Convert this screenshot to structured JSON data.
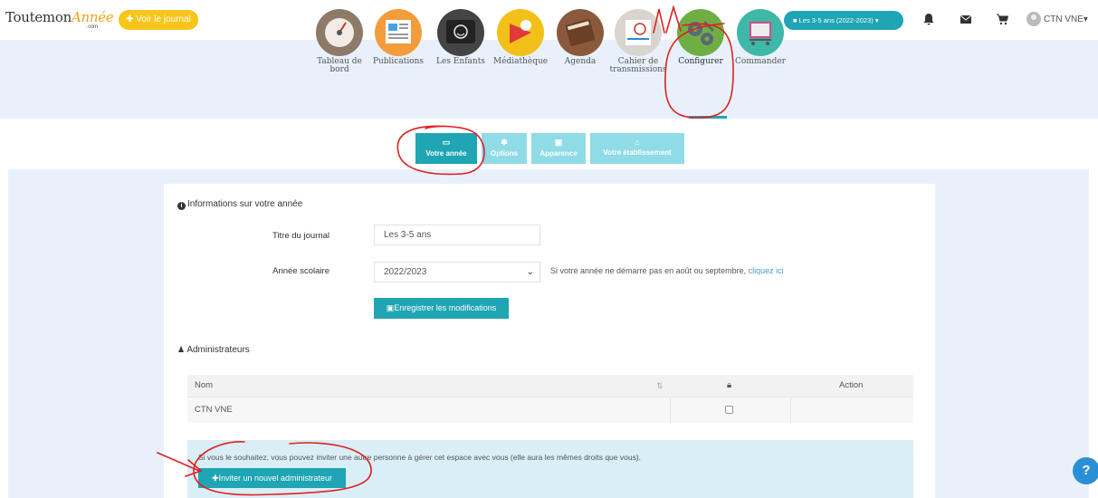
{
  "topbar": {
    "logo_main": "ToutemonAnnée",
    "logo_prefix": "Toutemon",
    "logo_script": "Année",
    "logo_suffix": ".com",
    "journal_button": "Voir le journal",
    "year_selector": "Les 3-5 ans (2022-2023)",
    "user_name": "CTN VNE",
    "icons": [
      "bell-icon",
      "envelope-icon",
      "cart-icon",
      "user-avatar-icon"
    ],
    "colors": {
      "yellow": "#f8c51a",
      "teal": "#1fa5b3"
    }
  },
  "nav": {
    "items": [
      {
        "label": "Tableau de bord",
        "icon": "dashboard-gauge-icon"
      },
      {
        "label": "Publications",
        "icon": "publications-icon"
      },
      {
        "label": "Les Enfants",
        "icon": "children-icon"
      },
      {
        "label": "Médiathèque",
        "icon": "media-library-icon"
      },
      {
        "label": "Agenda",
        "icon": "agenda-icon"
      },
      {
        "label": "Cahier de transmissions",
        "icon": "notebook-icon"
      },
      {
        "label": "Configurer",
        "icon": "gears-icon",
        "active": true
      },
      {
        "label": "Commander",
        "icon": "shopping-cart-icon"
      }
    ]
  },
  "subtabs": [
    {
      "label": "Votre année",
      "icon": "calendar-icon",
      "active": true
    },
    {
      "label": "Options",
      "icon": "gear-icon"
    },
    {
      "label": "Apparence",
      "icon": "image-icon"
    },
    {
      "label": "Votre établissement",
      "icon": "home-icon"
    }
  ],
  "year_info": {
    "title": "Informations sur votre année",
    "journal_title_label": "Titre du journal",
    "journal_title_value": "Les 3-5 ans",
    "school_year_label": "Année scolaire",
    "school_year_value": "2022/2023",
    "help_text": "Si votre année ne démarre pas en août ou septembre, ",
    "help_link": "cliquez ici",
    "save_button": "Enregistrer les modifications"
  },
  "admins": {
    "title": "Administrateurs",
    "columns": [
      "Nom",
      "",
      "",
      "Action"
    ],
    "rows": [
      {
        "name": "CTN VNE",
        "checked": false
      }
    ],
    "invite_text": "Si vous le souhaitez, vous pouvez inviter une autre personne à gérer cet espace avec vous (elle aura les mêmes droits que vous).",
    "invite_button": "Inviter un nouvel administrateur"
  },
  "annotation": {
    "number": "1",
    "color": "#e02020"
  },
  "help_button": "?"
}
